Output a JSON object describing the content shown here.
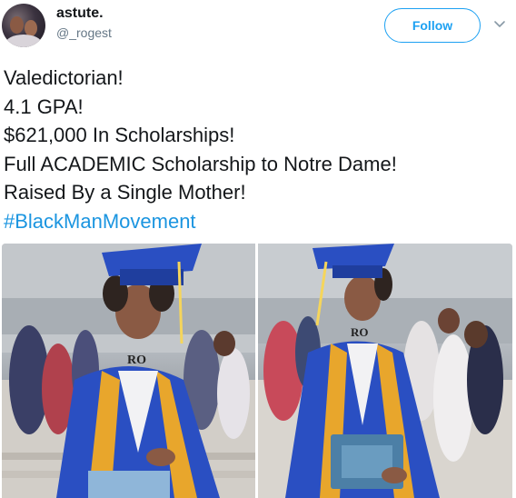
{
  "author": {
    "display_name": "astute.",
    "handle": "@_rogest"
  },
  "actions": {
    "follow_label": "Follow"
  },
  "tweet": {
    "lines": [
      "Valedictorian!",
      "4.1 GPA!",
      "$621,000 In Scholarships!",
      "Full ACADEMIC Scholarship to Notre Dame!",
      "Raised By a Single Mother!"
    ],
    "hashtag": "#BlackManMovement"
  },
  "media": {
    "photo_left_cap_text": "RO",
    "photo_right_cap_text": "RO"
  },
  "colors": {
    "accent": "#1da1f2",
    "hashtag": "#1b95e0",
    "gown": "#2a4fc2",
    "stole": "#e8a62c"
  },
  "icons": {
    "menu": "chevron-down-icon"
  }
}
